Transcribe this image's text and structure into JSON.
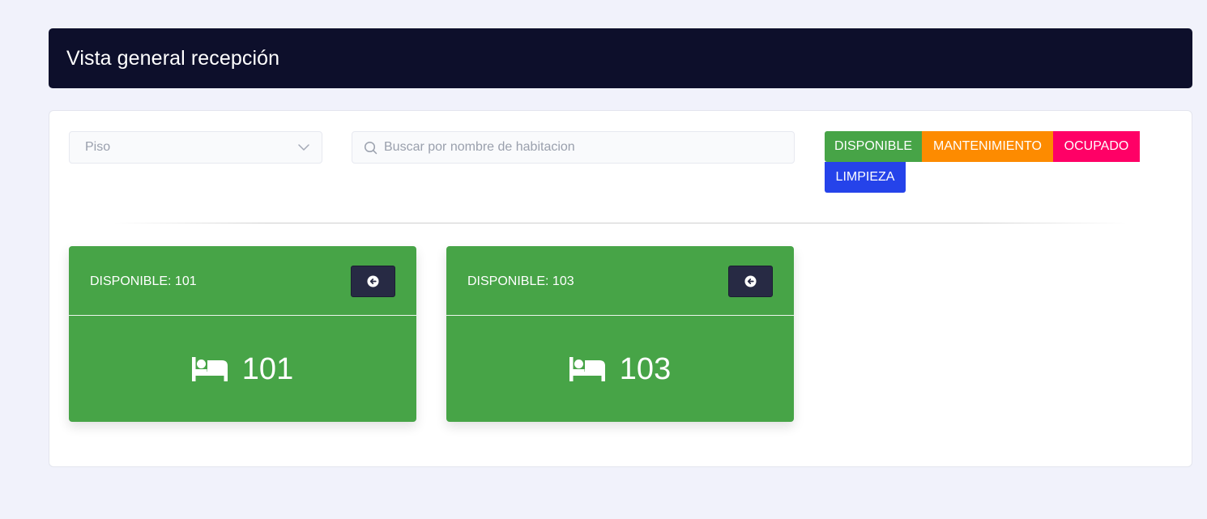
{
  "header": {
    "title": "Vista general recepción"
  },
  "filters": {
    "floor_placeholder": "Piso",
    "search_placeholder": "Buscar por nombre de habitacion"
  },
  "legend": {
    "disponible": "DISPONIBLE",
    "mantenimiento": "MANTENIMIENTO",
    "ocupado": "OCUPADO",
    "limpieza": "LIMPIEZA"
  },
  "colors": {
    "header_bg": "#0d0f2b",
    "disponible": "#47a447",
    "mantenimiento": "#fd8b00",
    "ocupado": "#ff0066",
    "limpieza": "#2543ea",
    "room_button": "#272a44"
  },
  "rooms": [
    {
      "status_label": "DISPONIBLE: 101",
      "number": "101",
      "icon": "bed-icon",
      "action_icon": "arrow-left-circle-icon"
    },
    {
      "status_label": "DISPONIBLE: 103",
      "number": "103",
      "icon": "bed-icon",
      "action_icon": "arrow-left-circle-icon"
    }
  ]
}
